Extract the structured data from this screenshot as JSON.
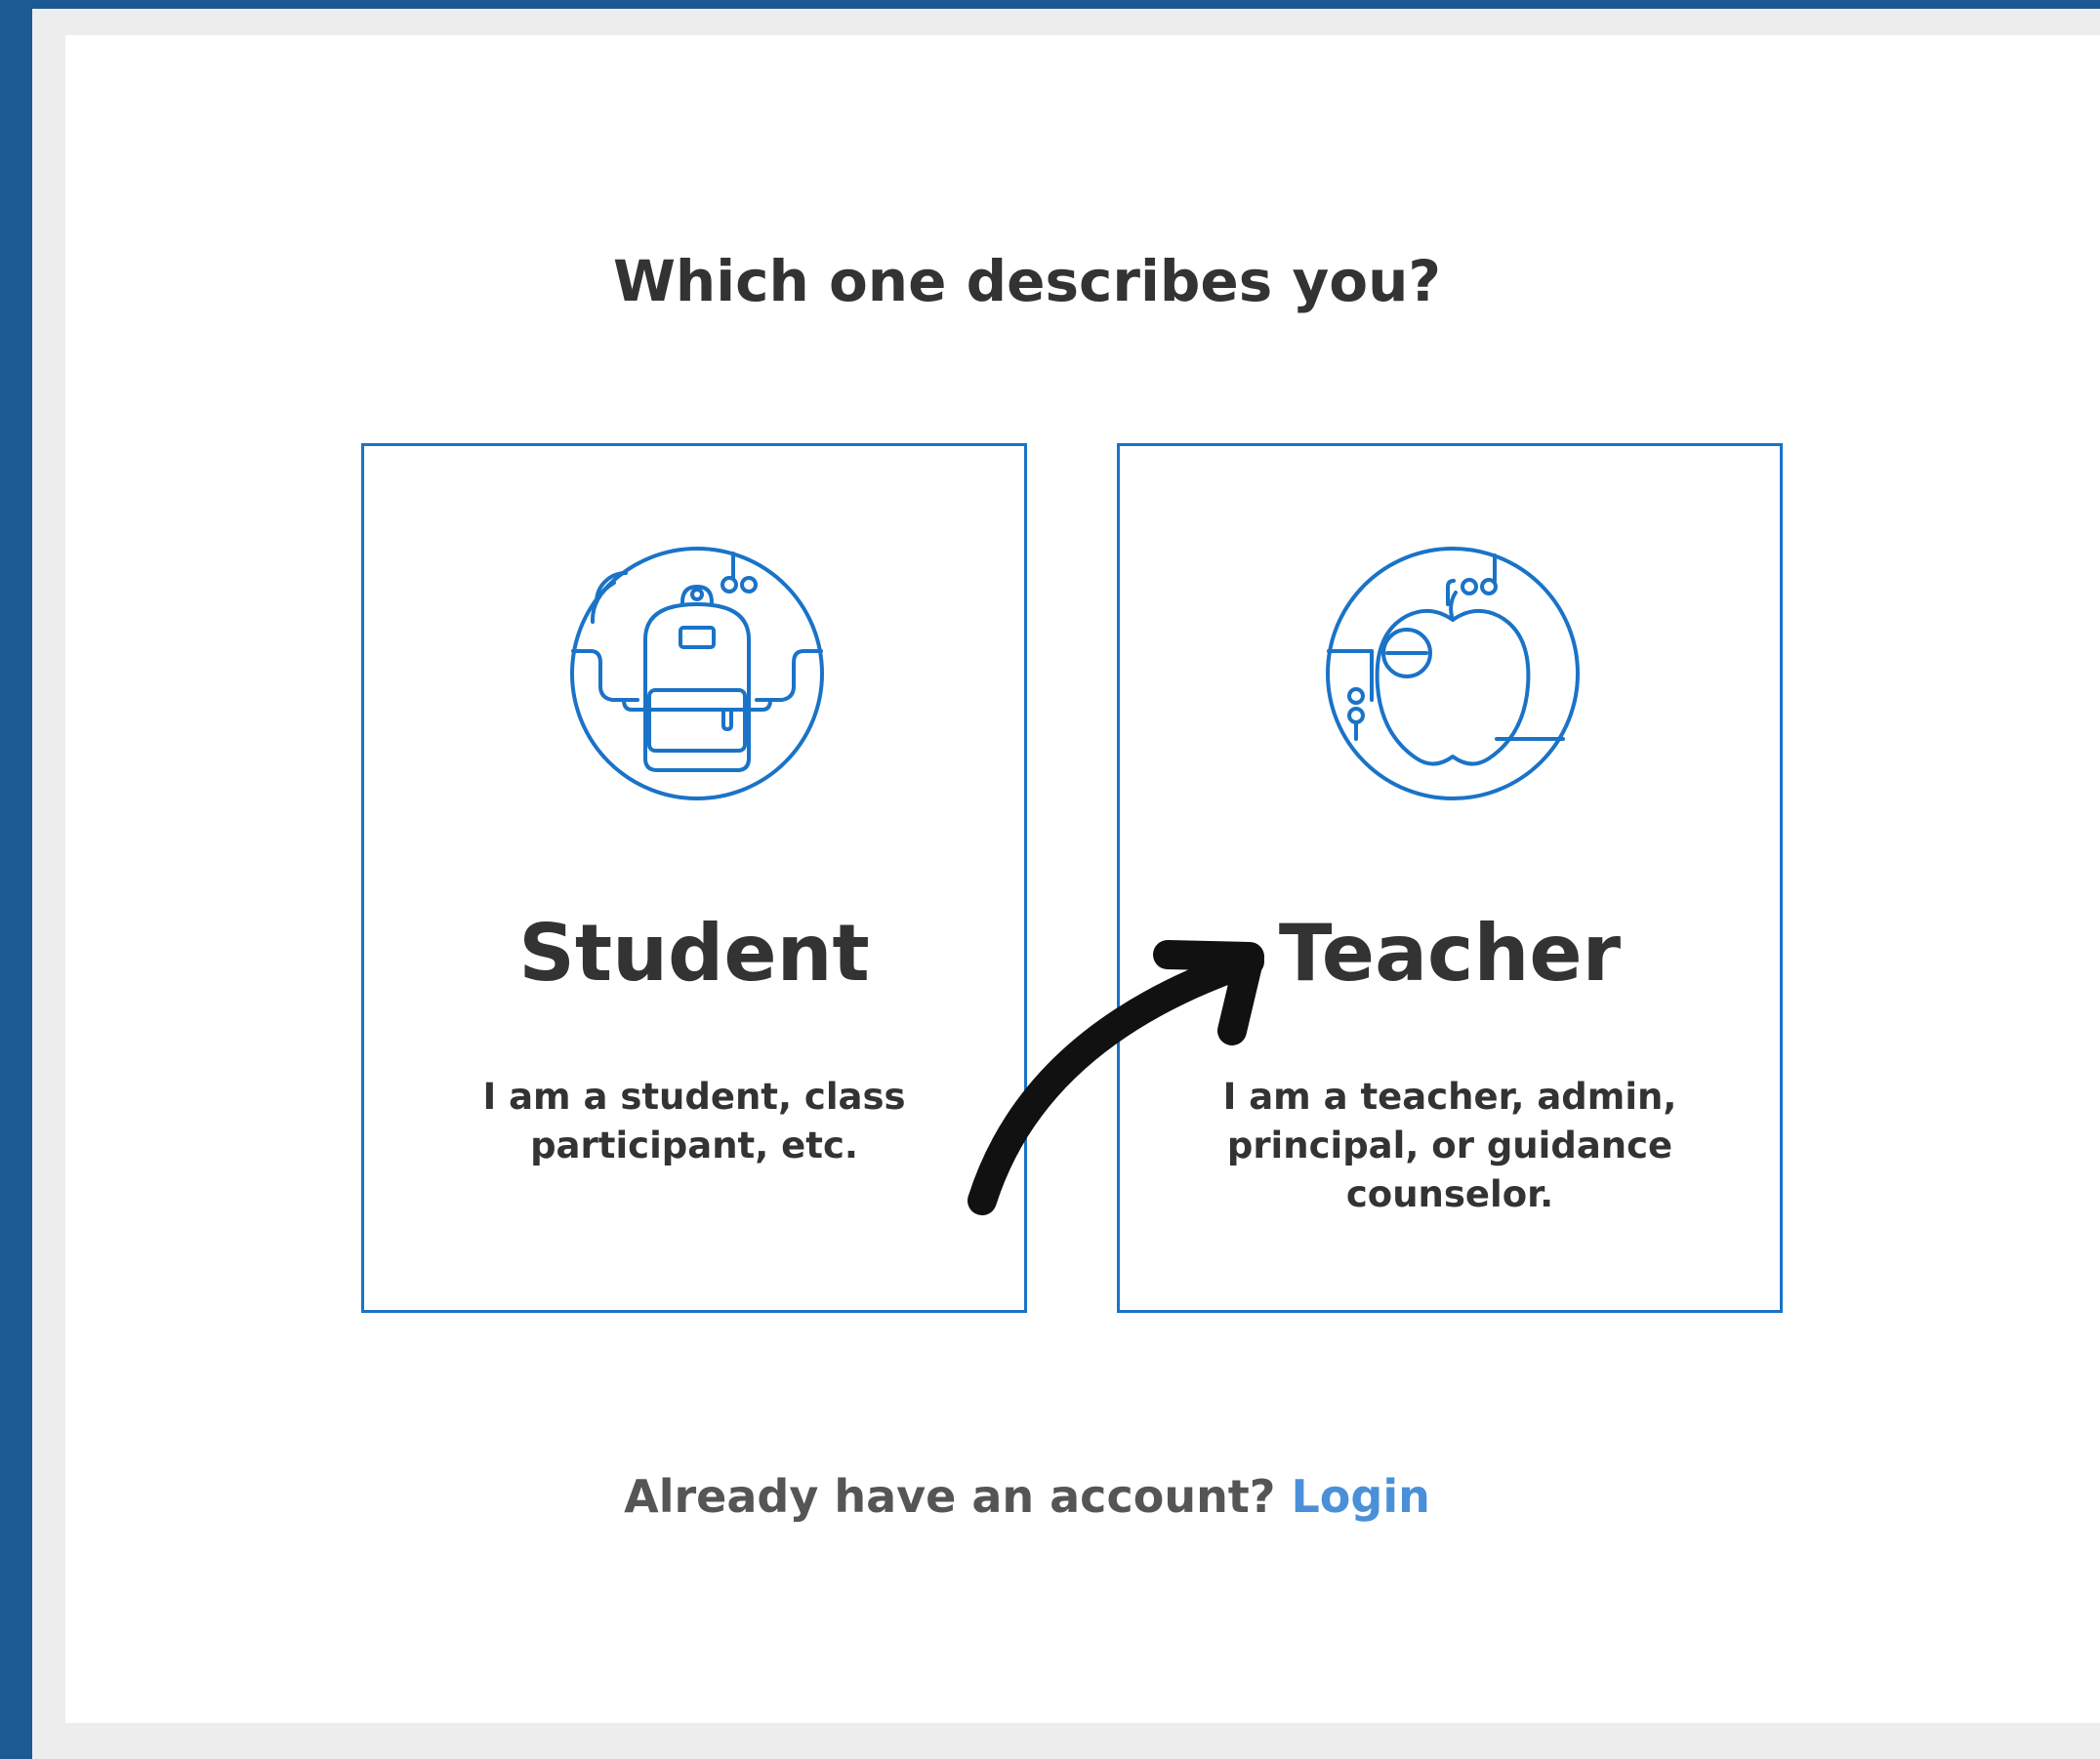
{
  "page": {
    "heading": "Which one describes you?"
  },
  "cards": [
    {
      "title": "Student",
      "description": "I am a student, class participant, etc.",
      "icon": "backpack-icon"
    },
    {
      "title": "Teacher",
      "description": "I am a teacher, admin, principal, or guidance counselor.",
      "icon": "apple-icon"
    }
  ],
  "footer": {
    "prompt": "Already have an account?",
    "login_label": "Login"
  },
  "colors": {
    "frame": "#1c5a93",
    "accent": "#1a73c7",
    "link": "#4a90d9",
    "text": "#333333"
  }
}
